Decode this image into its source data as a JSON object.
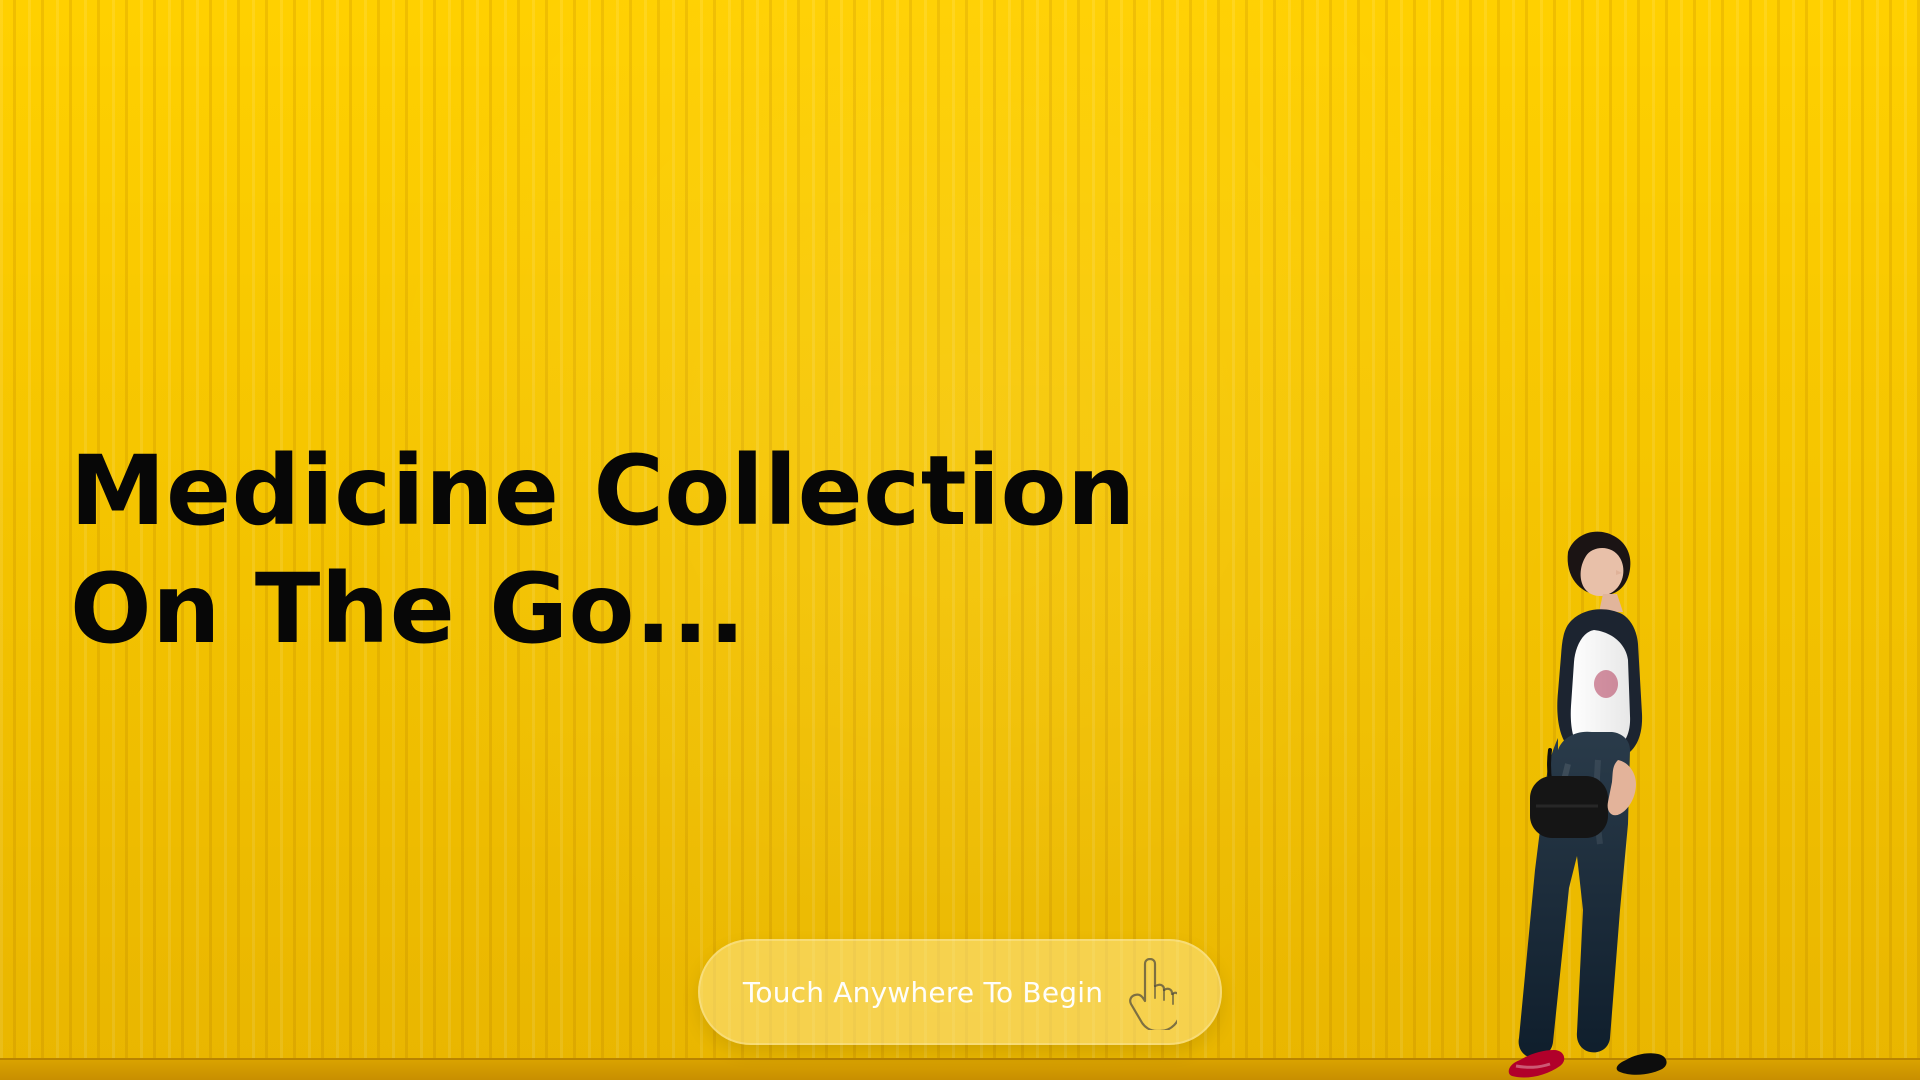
{
  "screen": {
    "headline": {
      "line1": "Medicine Collection",
      "line2": "On The Go..."
    },
    "cta": {
      "label": "Touch Anywhere To Begin",
      "icon": "hand-pointer-icon"
    },
    "colors": {
      "background": "#f7c400",
      "text": "#070707",
      "cta_text": "#ffffff"
    }
  }
}
